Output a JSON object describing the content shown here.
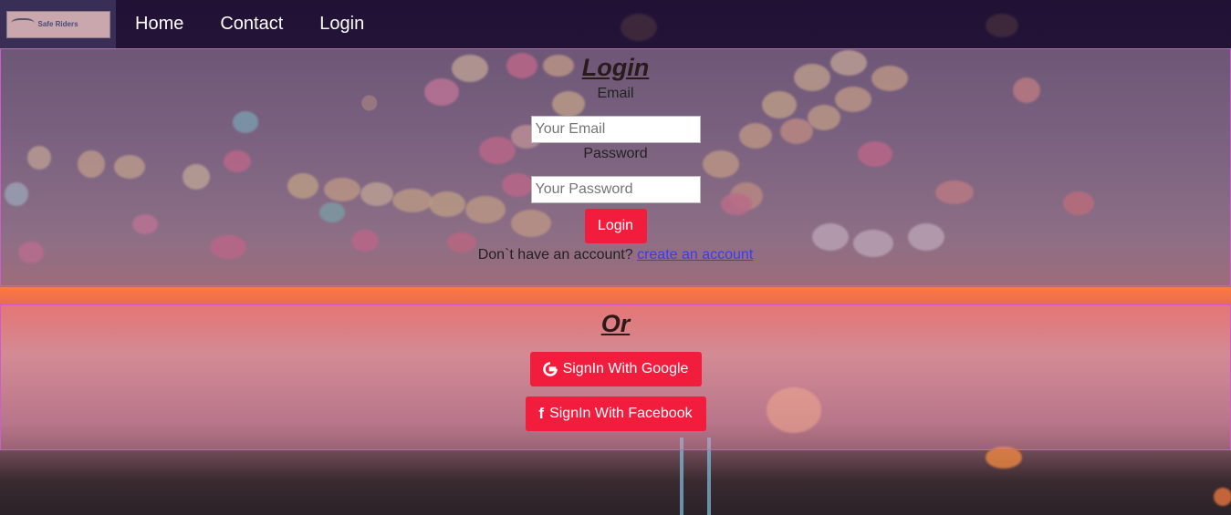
{
  "nav": {
    "logo_text": "Safe Riders",
    "links": [
      "Home",
      "Contact",
      "Login"
    ]
  },
  "login": {
    "title": "Login",
    "email_label": "Email",
    "email_placeholder": "Your Email",
    "password_label": "Password",
    "password_placeholder": "Your Password",
    "submit_label": "Login",
    "signup_prompt": "Don`t have an account?",
    "signup_link": "create an account"
  },
  "social": {
    "title": "Or",
    "google_label": "SignIn With Google",
    "facebook_label": "SignIn With Facebook",
    "google_icon": "google-icon",
    "facebook_icon": "facebook-icon"
  },
  "colors": {
    "accent": "#f21c3c",
    "nav_bg": "#1e0e32",
    "link": "#3a3aff"
  }
}
